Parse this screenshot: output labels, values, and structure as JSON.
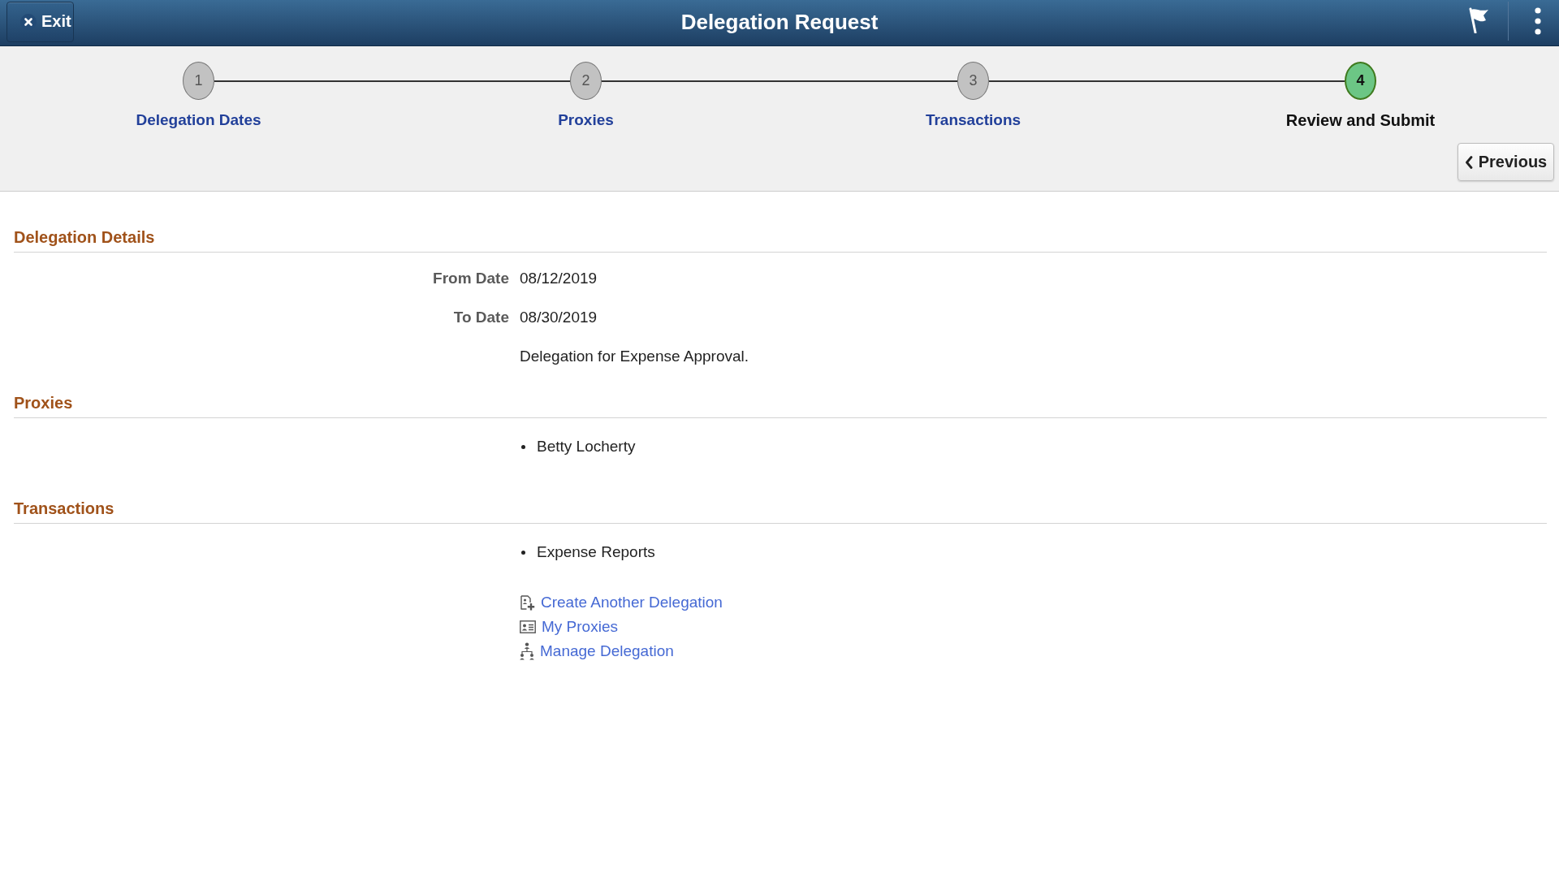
{
  "header": {
    "exit_button": "Exit",
    "title": "Delegation Request"
  },
  "steps": [
    {
      "number": "1",
      "label": "Delegation Dates",
      "selected": false
    },
    {
      "number": "2",
      "label": "Proxies",
      "selected": false
    },
    {
      "number": "3",
      "label": "Transactions",
      "selected": false
    },
    {
      "number": "4",
      "label": "Review and Submit",
      "selected": true
    }
  ],
  "previous_button": "Previous",
  "sections": [
    {
      "kind": "fields",
      "title": "Delegation Details",
      "fields": [
        {
          "label": "From Date",
          "value": "08/12/2019"
        },
        {
          "label": "To Date",
          "value": "08/30/2019"
        },
        {
          "value": "Delegation for Expense Approval."
        }
      ]
    },
    {
      "kind": "list",
      "title": "Proxies",
      "items": [
        "Betty Locherty"
      ]
    },
    {
      "kind": "list",
      "title": "Transactions",
      "items": [
        "Expense Reports"
      ]
    }
  ],
  "links": [
    "Create Another Delegation",
    "My Proxies",
    "Manage Delegation"
  ]
}
